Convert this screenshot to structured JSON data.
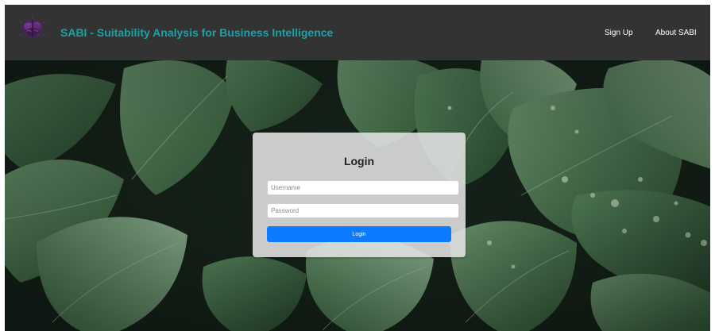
{
  "navbar": {
    "logo_icon": "brain-icon",
    "brand": "SABI - Suitability Analysis for Business Intelligence",
    "links": [
      "Sign Up",
      "About SABI"
    ]
  },
  "login": {
    "title": "Login",
    "username_placeholder": "Username",
    "password_placeholder": "Password",
    "button_label": "Login"
  },
  "colors": {
    "navbar_bg": "#333333",
    "brand_text": "#1aa3a8",
    "button_bg": "#0d7bff",
    "card_bg": "#e4e4e4"
  }
}
